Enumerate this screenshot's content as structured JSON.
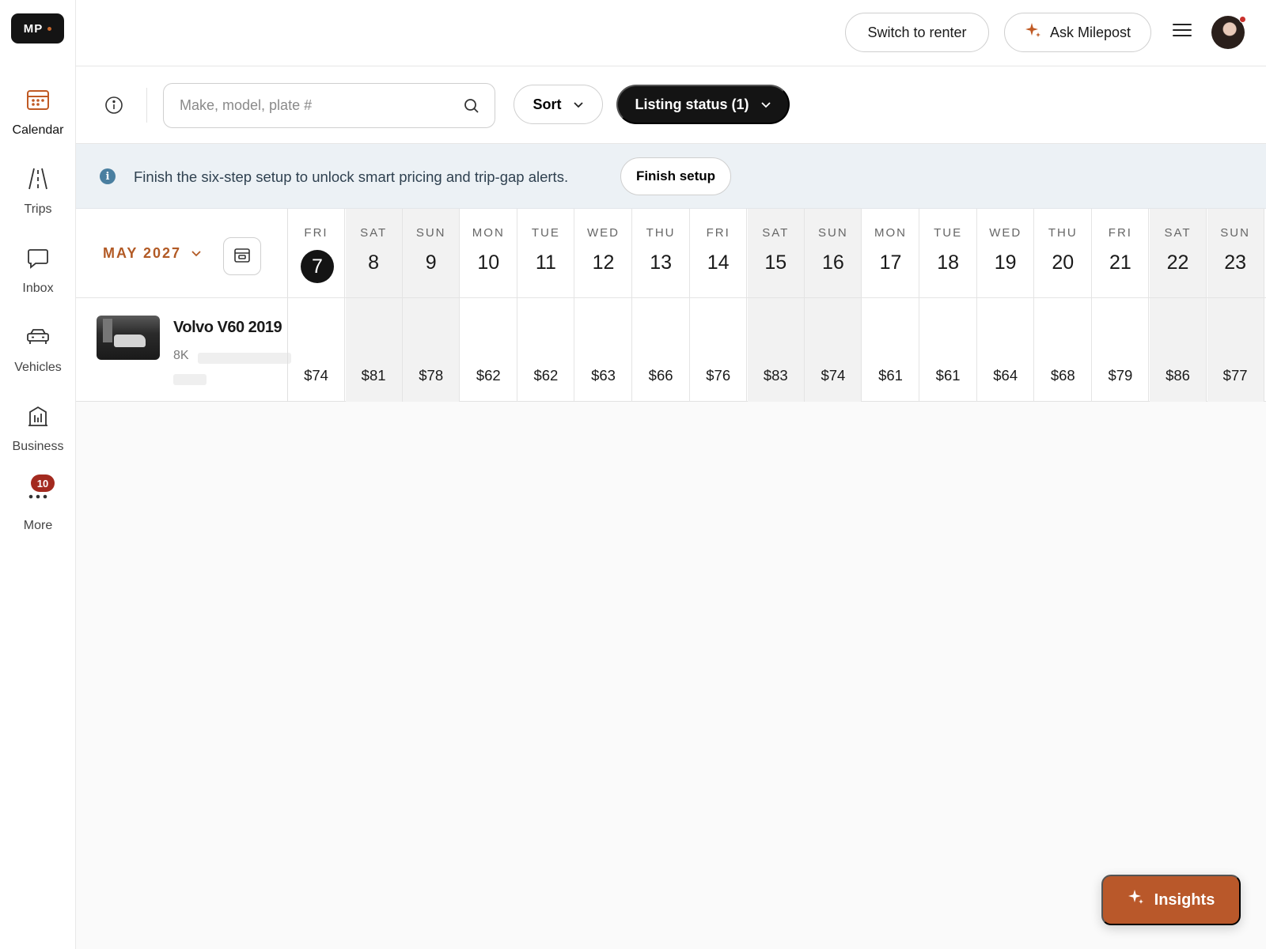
{
  "logo": {
    "text": "MP"
  },
  "sidebar": {
    "items": [
      {
        "label": "Calendar",
        "icon": "calendar-icon",
        "active": true
      },
      {
        "label": "Trips",
        "icon": "road-icon"
      },
      {
        "label": "Inbox",
        "icon": "chat-icon"
      },
      {
        "label": "Vehicles",
        "icon": "car-icon"
      },
      {
        "label": "Business",
        "icon": "building-icon"
      },
      {
        "label": "More",
        "icon": "more-icon",
        "badge": "10"
      }
    ]
  },
  "header": {
    "switch_label": "Switch to renter",
    "ask_label": "Ask Milepost"
  },
  "filters": {
    "search_placeholder": "Make, model, plate #",
    "sort_label": "Sort",
    "status_label": "Listing status (1)"
  },
  "banner": {
    "text": "Finish the six-step setup to unlock smart pricing and trip-gap alerts.",
    "button_label": "Finish setup"
  },
  "calendar": {
    "month_label": "MAY 2027",
    "days": [
      {
        "dow": "FRI",
        "num": "7",
        "price": "$74",
        "today": true,
        "weekend": false
      },
      {
        "dow": "SAT",
        "num": "8",
        "price": "$81",
        "weekend": true
      },
      {
        "dow": "SUN",
        "num": "9",
        "price": "$78",
        "weekend": true
      },
      {
        "dow": "MON",
        "num": "10",
        "price": "$62",
        "weekend": false
      },
      {
        "dow": "TUE",
        "num": "11",
        "price": "$62",
        "weekend": false
      },
      {
        "dow": "WED",
        "num": "12",
        "price": "$63",
        "weekend": false
      },
      {
        "dow": "THU",
        "num": "13",
        "price": "$66",
        "weekend": false
      },
      {
        "dow": "FRI",
        "num": "14",
        "price": "$76",
        "weekend": false
      },
      {
        "dow": "SAT",
        "num": "15",
        "price": "$83",
        "weekend": true
      },
      {
        "dow": "SUN",
        "num": "16",
        "price": "$74",
        "weekend": true
      },
      {
        "dow": "MON",
        "num": "17",
        "price": "$61",
        "weekend": false
      },
      {
        "dow": "TUE",
        "num": "18",
        "price": "$61",
        "weekend": false
      },
      {
        "dow": "WED",
        "num": "19",
        "price": "$64",
        "weekend": false
      },
      {
        "dow": "THU",
        "num": "20",
        "price": "$68",
        "weekend": false
      },
      {
        "dow": "FRI",
        "num": "21",
        "price": "$79",
        "weekend": false
      },
      {
        "dow": "SAT",
        "num": "22",
        "price": "$86",
        "weekend": true
      },
      {
        "dow": "SUN",
        "num": "23",
        "price": "$77",
        "weekend": true
      }
    ]
  },
  "vehicle": {
    "name": "Volvo V60 2019",
    "miles": "8K"
  },
  "insights": {
    "label": "Insights"
  },
  "colors": {
    "accent": "#b9582a",
    "dark": "#141414",
    "banner_bg": "#ecf1f5",
    "badge": "#a32a1f"
  }
}
